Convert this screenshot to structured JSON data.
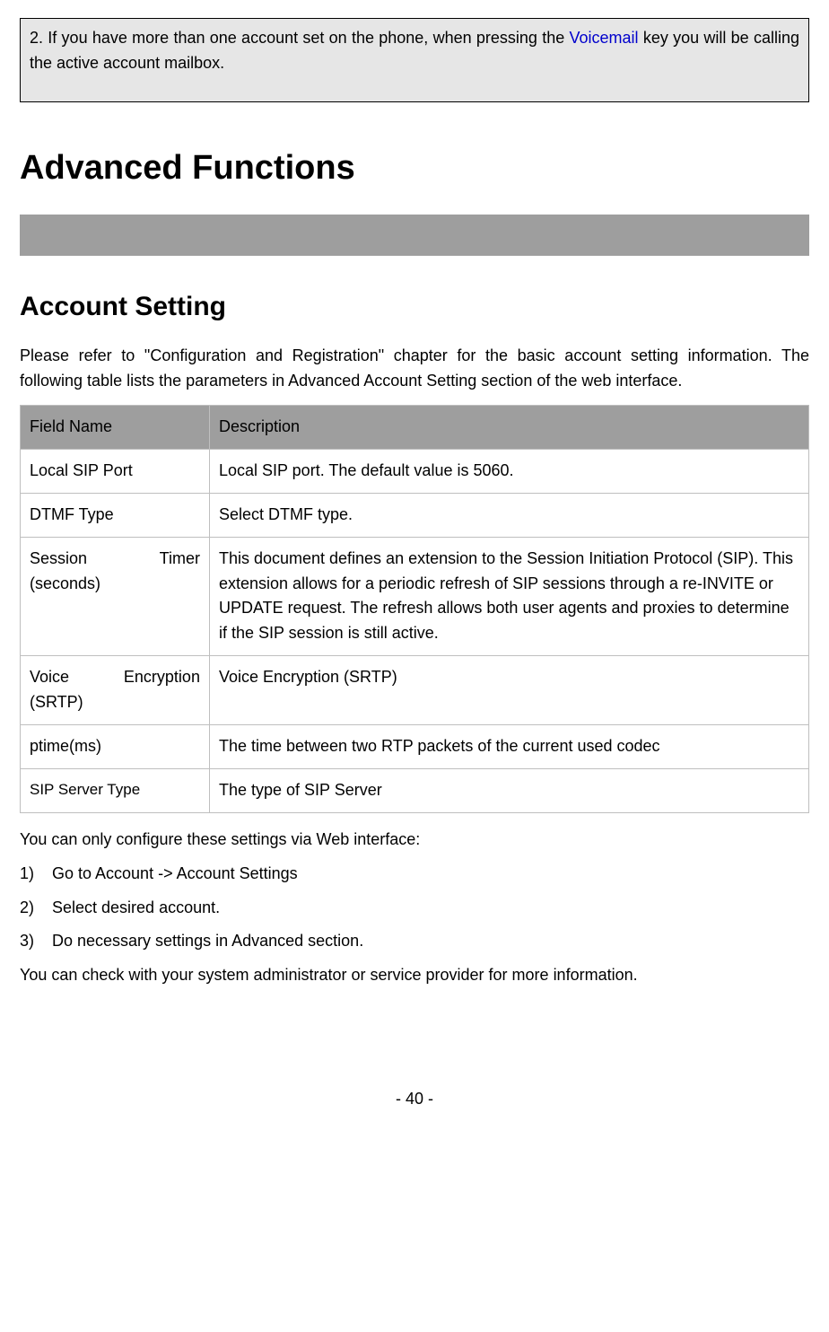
{
  "note": {
    "prefix": "2. If you have more than one account set on the phone, when pressing the ",
    "voicemail": "Voicemail",
    "suffix": " key you will be calling the active account mailbox."
  },
  "headings": {
    "h1": "Advanced Functions",
    "h2": "Account Setting"
  },
  "intro": "Please refer to \"Configuration and Registration\" chapter for the basic account setting information. The following table lists the parameters in Advanced Account Setting section of the web interface.",
  "table": {
    "headers": {
      "field": "Field Name",
      "desc": "Description"
    },
    "rows": [
      {
        "field": "Local SIP Port",
        "desc": "Local SIP port. The default value is 5060."
      },
      {
        "field": "DTMF Type",
        "desc": "Select DTMF type."
      },
      {
        "field_a": "Session",
        "field_b": "Timer",
        "field_c": "(seconds)",
        "desc": "This document defines an extension to the Session Initiation Protocol (SIP). This extension allows for a periodic refresh of SIP sessions through a re-INVITE or UPDATE request. The refresh allows both user agents and proxies to determine if the SIP session is still active."
      },
      {
        "field_a": "Voice",
        "field_b": "Encryption",
        "field_c": "(SRTP)",
        "desc": "Voice Encryption (SRTP)"
      },
      {
        "field": "ptime(ms)",
        "desc": "The time between two RTP packets of the current used codec"
      },
      {
        "field": "SIP Server Type",
        "desc": "The type of SIP Server"
      }
    ]
  },
  "after_table": "You can only configure these settings via Web interface:",
  "steps": [
    {
      "num": "1)",
      "text": "Go to Account -> Account Settings"
    },
    {
      "num": "2)",
      "text": "Select desired account."
    },
    {
      "num": "3)",
      "text": "Do necessary settings in Advanced section."
    }
  ],
  "closing": "You can check with your system administrator or service provider for more information.",
  "page_number": "- 40 -"
}
